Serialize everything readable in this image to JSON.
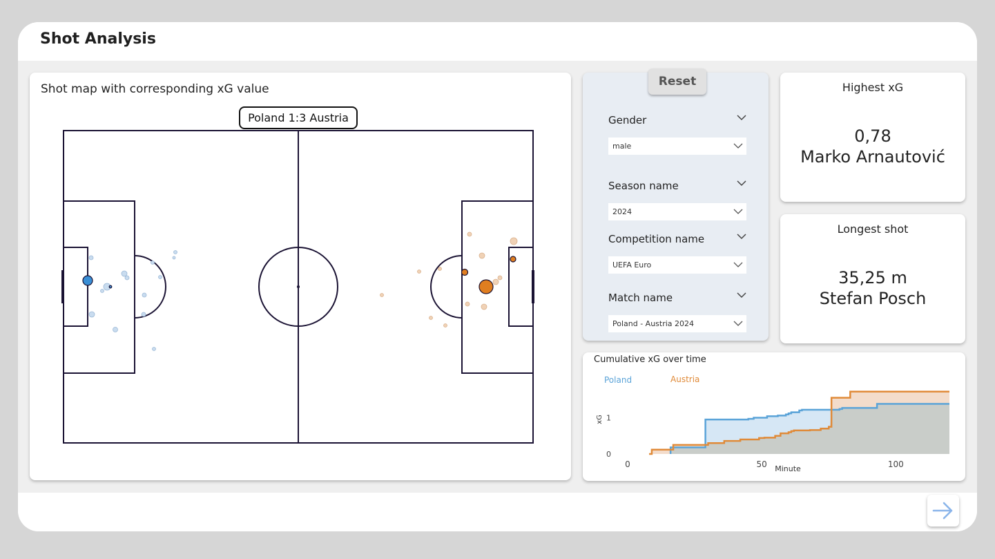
{
  "page": {
    "title": "Shot Analysis"
  },
  "shot_map": {
    "title": "Shot map with corresponding xG value",
    "score_label": "Poland 1:3 Austria",
    "colors": {
      "home": "#3a8fd6",
      "home_light": "#c9dcef",
      "away": "#e07e20",
      "away_light": "#f0d2b6"
    }
  },
  "filters": {
    "reset_label": "Reset",
    "items": [
      {
        "label": "Gender",
        "value": "male"
      },
      {
        "label": "Season name",
        "value": "2024"
      },
      {
        "label": "Competition name",
        "value": "UEFA Euro"
      },
      {
        "label": "Match name",
        "value": "Poland - Austria 2024"
      }
    ]
  },
  "kpis": {
    "highest_xg": {
      "label": "Highest xG",
      "value": "0,78",
      "player": "Marko Arnautović"
    },
    "longest_shot": {
      "label": "Longest shot",
      "value": "35,25 m",
      "player": "Stefan Posch"
    }
  },
  "chart_data": {
    "type": "area",
    "title": "Cumulative xG over time",
    "xlabel": "Minute",
    "ylabel": "xG",
    "xlim": [
      0,
      120
    ],
    "ylim": [
      0,
      2
    ],
    "xticks": [
      0,
      50,
      100
    ],
    "yticks": [
      0,
      1
    ],
    "legend_position": "top-left",
    "series": [
      {
        "name": "Poland",
        "color": "#5aa3d8",
        "fill": "#cfe3f3",
        "x": [
          16,
          16,
          29,
          29,
          44,
          45,
          47,
          52,
          56,
          59,
          60,
          61,
          64,
          65,
          76,
          79,
          80,
          92,
          93,
          120
        ],
        "y": [
          0,
          0.18,
          0.18,
          0.95,
          0.95,
          0.97,
          1.0,
          1.04,
          1.06,
          1.09,
          1.12,
          1.15,
          1.2,
          1.22,
          1.22,
          1.24,
          1.27,
          1.27,
          1.38,
          1.38
        ]
      },
      {
        "name": "Austria",
        "color": "#e08a38",
        "fill": "#f3dccb",
        "x": [
          8,
          9,
          9,
          16,
          17,
          30,
          36,
          42,
          49,
          51,
          55,
          57,
          60,
          61,
          62,
          68,
          72,
          75,
          76,
          81,
          83,
          120
        ],
        "y": [
          0,
          0,
          0.12,
          0.12,
          0.25,
          0.3,
          0.36,
          0.4,
          0.44,
          0.45,
          0.5,
          0.57,
          0.6,
          0.63,
          0.65,
          0.66,
          0.7,
          0.75,
          1.55,
          1.55,
          1.72,
          1.72
        ]
      }
    ]
  }
}
